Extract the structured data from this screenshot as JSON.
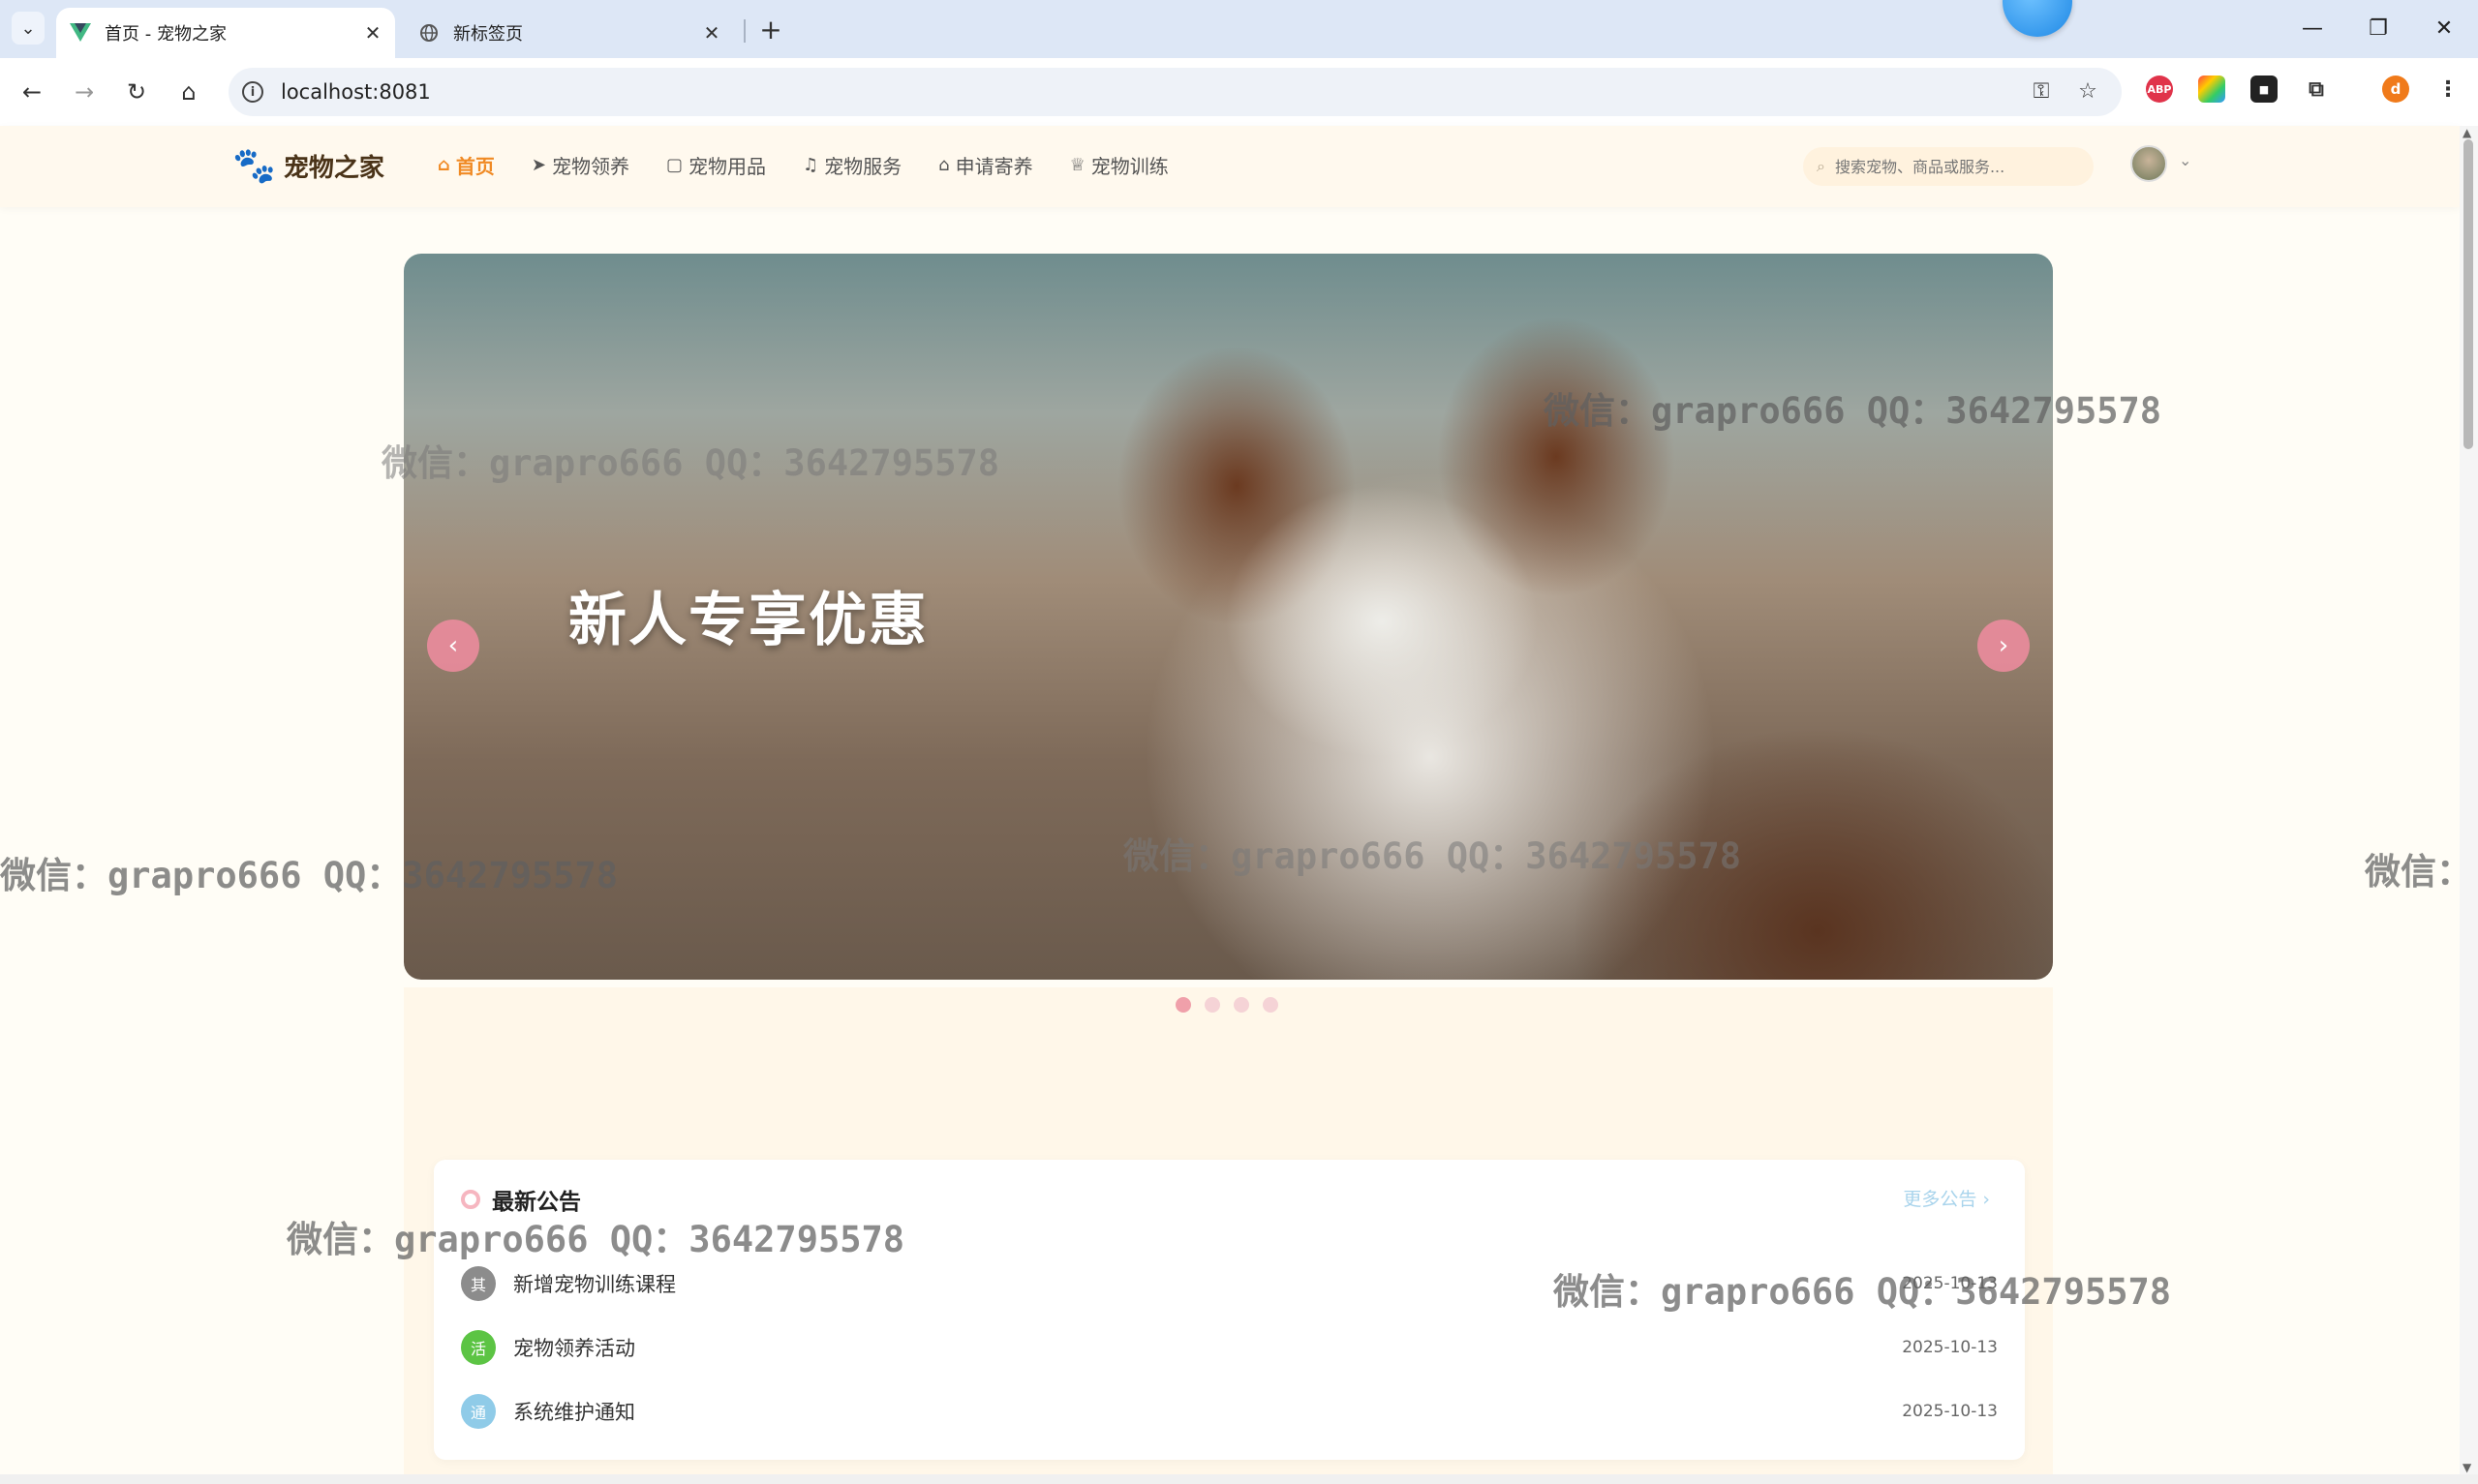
{
  "browser": {
    "tabs": [
      {
        "title": "首页 - 宠物之家",
        "active": true
      },
      {
        "title": "新标签页",
        "active": false
      }
    ],
    "url": "localhost:8081",
    "extension_abp_label": "ABP",
    "profile_initial": "d"
  },
  "site": {
    "logo_text": "宠物之家",
    "nav": [
      {
        "label": "首页",
        "icon": "home-icon",
        "active": true
      },
      {
        "label": "宠物领养",
        "icon": "send-icon",
        "active": false
      },
      {
        "label": "宠物用品",
        "icon": "bag-icon",
        "active": false
      },
      {
        "label": "宠物服务",
        "icon": "headset-icon",
        "active": false
      },
      {
        "label": "申请寄养",
        "icon": "house-icon",
        "active": false
      },
      {
        "label": "宠物训练",
        "icon": "trophy-icon",
        "active": false
      }
    ],
    "search_placeholder": "搜索宠物、商品或服务...",
    "accent_color": "#f08a24"
  },
  "carousel": {
    "slide_title": "新人专享优惠",
    "prev_label": "‹",
    "next_label": "›",
    "slide_count": 4,
    "active_index": 0
  },
  "notice": {
    "title": "最新公告",
    "more_label": "更多公告",
    "items": [
      {
        "tag": "其",
        "tag_color": "#8c8c8c",
        "text": "新增宠物训练课程",
        "date": "2025-10-13"
      },
      {
        "tag": "活",
        "tag_color": "#5cc444",
        "text": "宠物领养活动",
        "date": "2025-10-13"
      },
      {
        "tag": "通",
        "tag_color": "#8fcbe8",
        "text": "系统维护通知",
        "date": "2025-10-13"
      }
    ]
  },
  "watermarks": {
    "text": "微信：grapro666 QQ：3642795578",
    "partial": "微信："
  }
}
